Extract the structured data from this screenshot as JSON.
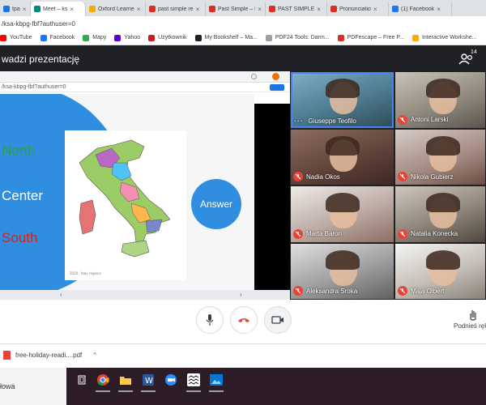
{
  "browser": {
    "tabs": [
      {
        "label": "tpa",
        "color": "#1a73e8"
      },
      {
        "label": "Meet – ks",
        "color": "#00897b",
        "active": true
      },
      {
        "label": "Oxford Learne",
        "color": "#f9ab00"
      },
      {
        "label": "past simple re",
        "color": "#d93025"
      },
      {
        "label": "Past Simple – E",
        "color": "#d93025"
      },
      {
        "label": "PAST SIMPLE",
        "color": "#d93025"
      },
      {
        "label": "Pronunciatio",
        "color": "#d93025"
      },
      {
        "label": "(1) Facebook",
        "color": "#1877f2"
      }
    ],
    "url": "/ksa-kbpg-fbf?authuser=0",
    "bookmarks": [
      {
        "label": "YouTube",
        "color": "#ff0000"
      },
      {
        "label": "Facebook",
        "color": "#1877f2"
      },
      {
        "label": "Mapy",
        "color": "#34a853"
      },
      {
        "label": "Yahoo",
        "color": "#6001d2"
      },
      {
        "label": "Użytkownik",
        "color": "#c5221f"
      },
      {
        "label": "My Bookshelf – Ma...",
        "color": "#202124"
      },
      {
        "label": "PDF24 Tools: Darm...",
        "color": "#9aa0a6"
      },
      {
        "label": "PDFescape – Free P...",
        "color": "#d93025"
      },
      {
        "label": "Interactive Workshe...",
        "color": "#f9ab00"
      }
    ]
  },
  "meet": {
    "presenter_title": "wadzi prezentację",
    "participant_count": "14",
    "shared_url": "/ksa-kbpg-fbf?authuser=0",
    "slide": {
      "regions": [
        {
          "label": "North",
          "color": "#2e9e44"
        },
        {
          "label": "Center",
          "color": "#ffffff"
        },
        {
          "label": "South",
          "color": "#c62828"
        }
      ],
      "answer_button": "Answer",
      "accent": "#2f8ee0"
    },
    "participants": [
      {
        "name": "Giuseppe Teofilo",
        "muted": false,
        "speaking": true
      },
      {
        "name": "Antoni Larski",
        "muted": true
      },
      {
        "name": "Nadia Okos",
        "muted": true
      },
      {
        "name": "Nikola Gubierz",
        "muted": true
      },
      {
        "name": "Marta Baron",
        "muted": true
      },
      {
        "name": "Natalia Konecka",
        "muted": true
      },
      {
        "name": "Aleksandra Sroka",
        "muted": true
      },
      {
        "name": "Maja Olbert",
        "muted": true
      }
    ],
    "controls": {
      "present_label": "Podnieś rękę"
    }
  },
  "downloads": {
    "file": "free-holiday-readi....pdf"
  },
  "taskbar": {
    "search_text": "łowa"
  }
}
